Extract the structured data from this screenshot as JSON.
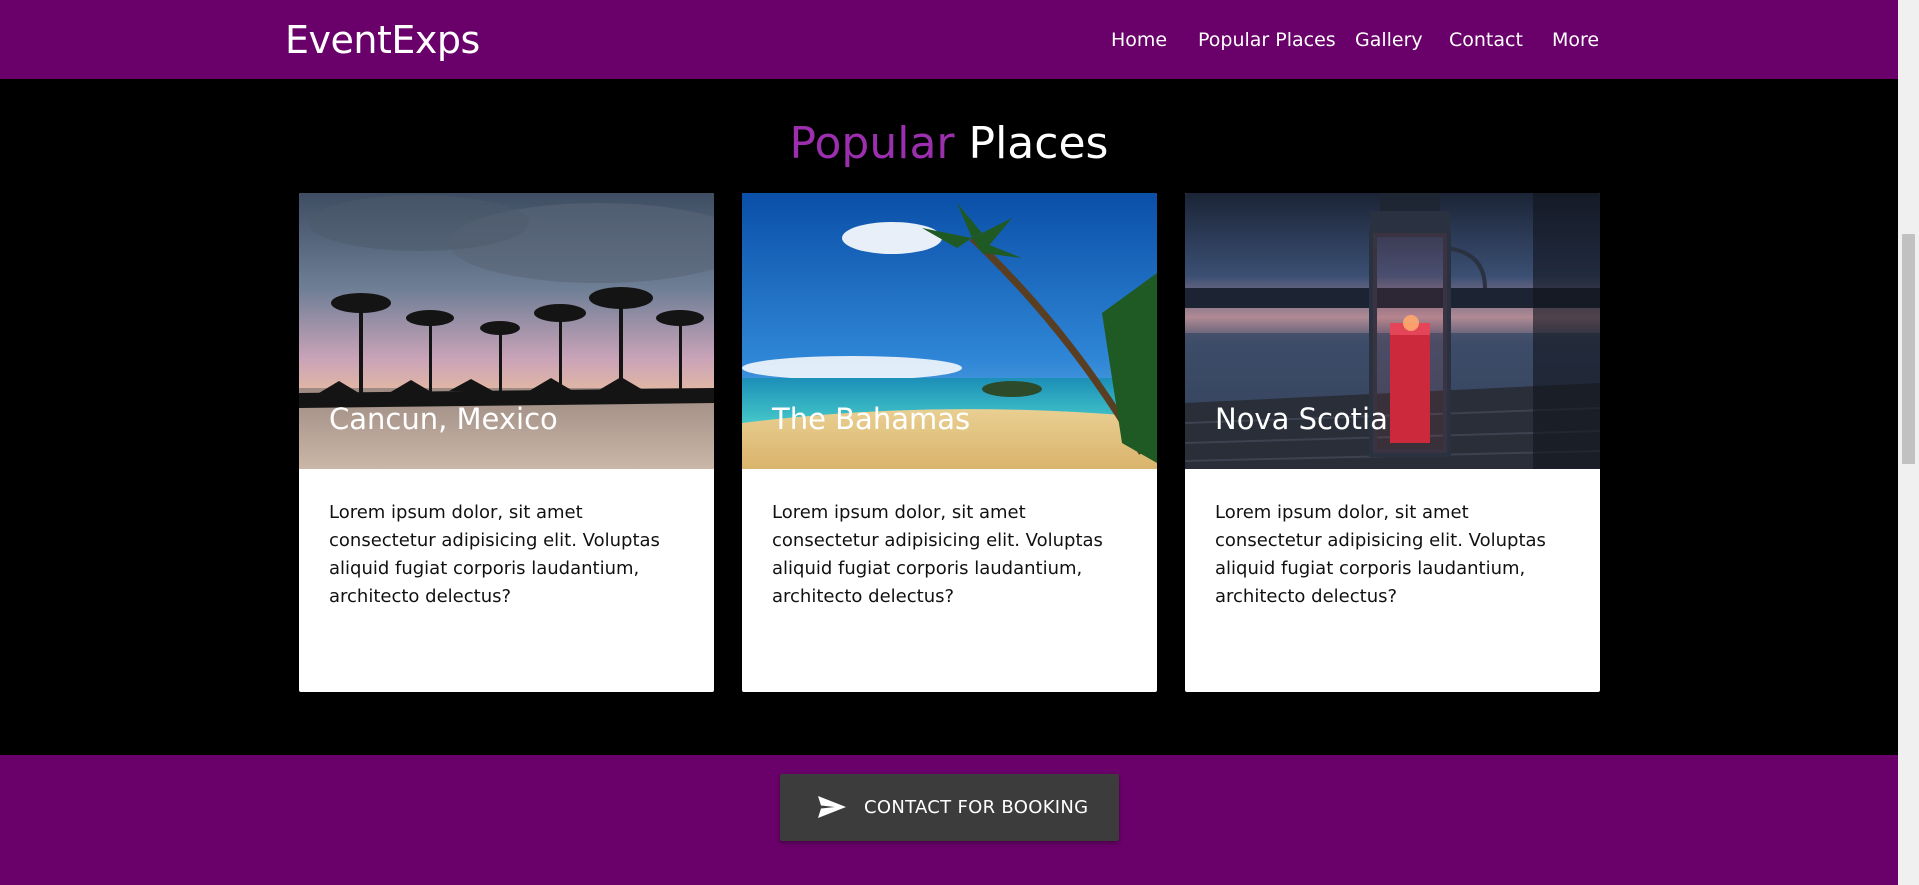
{
  "brand": "EventExps",
  "nav": {
    "home": "Home",
    "popular_places": "Popular Places",
    "gallery": "Gallery",
    "contact": "Contact",
    "more": "More"
  },
  "section": {
    "title_accent": "Popular",
    "title_main": "Places"
  },
  "cards": [
    {
      "title": "Cancun, Mexico",
      "text": "Lorem ipsum dolor, sit amet consectetur adipisicing elit. Voluptas aliquid fugiat corporis laudantium, architecto delectus?"
    },
    {
      "title": "The Bahamas",
      "text": "Lorem ipsum dolor, sit amet consectetur adipisicing elit. Voluptas aliquid fugiat corporis laudantium, architecto delectus?"
    },
    {
      "title": "Nova Scotia",
      "text": "Lorem ipsum dolor, sit amet consectetur adipisicing elit. Voluptas aliquid fugiat corporis laudantium, architecto delectus?"
    }
  ],
  "booking_button": {
    "label": "CONTACT FOR BOOKING",
    "icon": "send-icon"
  },
  "colors": {
    "primary": "#6a006a",
    "accent": "#9b2fae",
    "section_bg": "#000000",
    "button_bg": "#3c3c3c"
  }
}
